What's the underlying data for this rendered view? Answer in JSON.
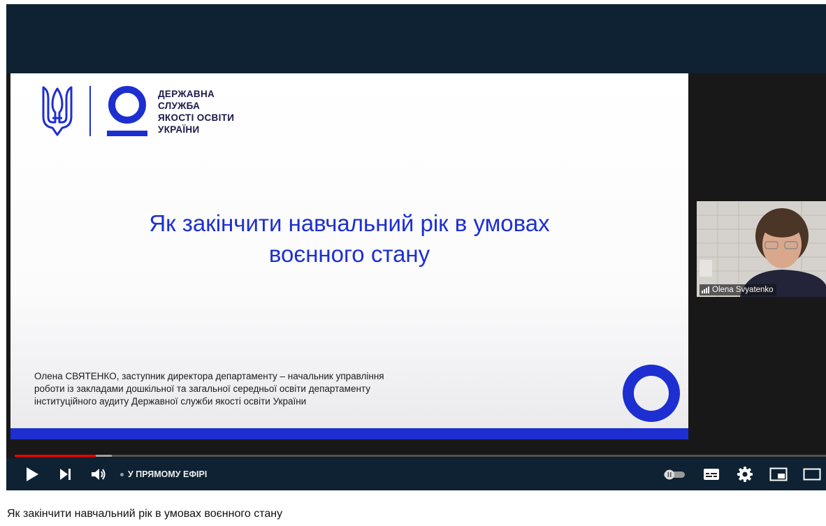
{
  "slide": {
    "org_name": "ДЕРЖАВНА\nСЛУЖБА\nЯКОСТІ ОСВІТИ\nУКРАЇНИ",
    "title": "Як закінчити навчальний рік в умовах\nвоєнного стану",
    "presenter_info": "Олена СВЯТЕНКО, заступник директора департаменту – начальник управління\nроботи із закладами дошкільної та загальної середньої освіти департаменту\nінституційного аудиту Державної служби якості освіти України",
    "brand_color": "#1d2fd0"
  },
  "webcam": {
    "participant_name": "Olena Svyatenko"
  },
  "player": {
    "live_label": "У ПРЯМОМУ ЕФІРІ",
    "progress_played_fraction": 0.1,
    "progress_buffered_fraction": 0.12,
    "accent_color": "#ff0000",
    "icons": {
      "play": "play-icon",
      "next": "next-icon",
      "volume": "volume-icon",
      "autoplay": "autoplay-toggle-icon",
      "subtitles": "subtitles-icon",
      "settings": "gear-icon",
      "miniplayer": "miniplayer-icon",
      "theater": "theater-mode-icon"
    }
  },
  "video": {
    "title": "Як закінчити навчальний рік в умовах воєнного стану"
  }
}
